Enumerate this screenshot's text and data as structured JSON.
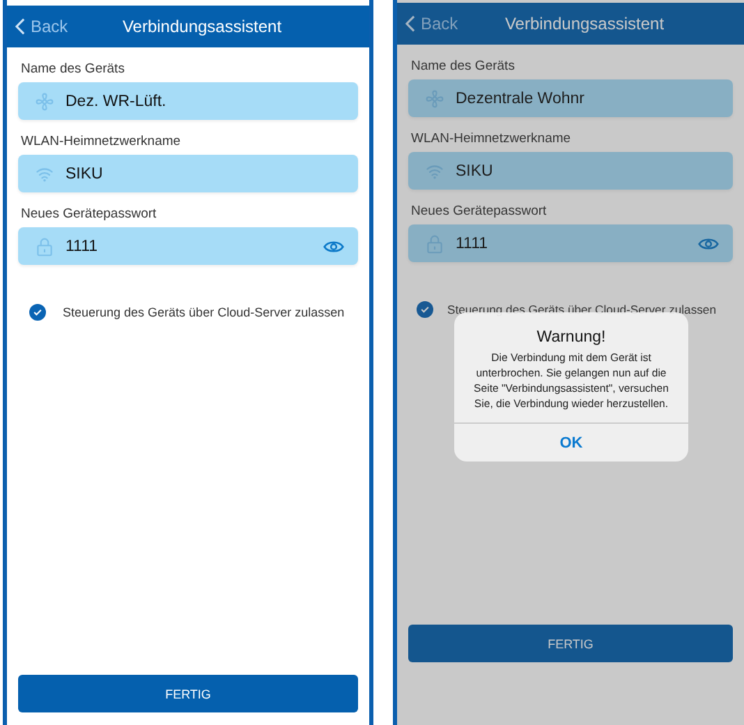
{
  "screens": [
    {
      "header": {
        "back": "Back",
        "title": "Verbindungsassistent"
      },
      "fields": [
        {
          "kind": "fan",
          "label": "Name des Geräts",
          "value": "Dez. WR-Lüft."
        },
        {
          "kind": "wifi",
          "label": "WLAN-Heimnetzwerkname",
          "value": "SIKU"
        },
        {
          "kind": "password",
          "label": "Neues Gerätepasswort",
          "value": "1111"
        }
      ],
      "checkbox": {
        "label": "Steuerung des Geräts über Cloud-Server zulassen",
        "checked": true
      },
      "button": "FERTIG"
    },
    {
      "header": {
        "back": "Back",
        "title": "Verbindungsassistent"
      },
      "fields": [
        {
          "kind": "fan",
          "label": "Name des Geräts",
          "value": "Dezentrale Wohnr"
        },
        {
          "kind": "wifi",
          "label": "WLAN-Heimnetzwerkname",
          "value": "SIKU"
        },
        {
          "kind": "password",
          "label": "Neues Gerätepasswort",
          "value": "1111"
        }
      ],
      "checkbox": {
        "label": "Steuerung des Geräts über Cloud-Server zulassen",
        "checked": true
      },
      "button": "FERTIG",
      "dialog": {
        "title": "Warnung!",
        "message": "Die Verbindung mit dem Gerät ist unterbrochen. Sie gelangen nun auf die Seite \"Verbindungsassistent\", versuchen Sie, die Verbindung wieder herzustellen.",
        "button": "OK"
      }
    }
  ]
}
